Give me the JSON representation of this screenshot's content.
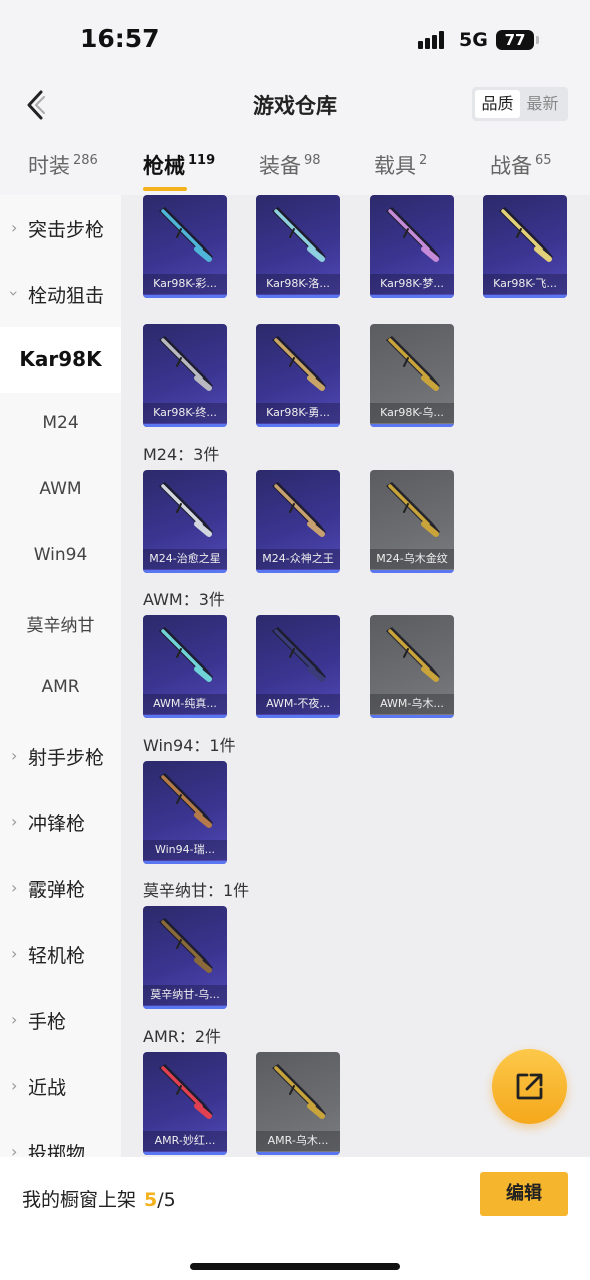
{
  "status": {
    "time": "16:57",
    "network": "5G",
    "battery": "77"
  },
  "header": {
    "title": "游戏仓库",
    "sort": [
      "品质",
      "最新"
    ]
  },
  "tabs": [
    {
      "label": "时装",
      "count": "286"
    },
    {
      "label": "枪械",
      "count": "119"
    },
    {
      "label": "装备",
      "count": "98"
    },
    {
      "label": "载具",
      "count": "2"
    },
    {
      "label": "战备",
      "count": "65"
    }
  ],
  "sidebar": [
    {
      "label": "突击步枪",
      "chevron": "chevron-right-icon"
    },
    {
      "label": "栓动狙击",
      "chevron": "chevron-down-icon"
    },
    {
      "label": "Kar98K"
    },
    {
      "label": "M24"
    },
    {
      "label": "AWM"
    },
    {
      "label": "Win94"
    },
    {
      "label": "莫辛纳甘"
    },
    {
      "label": "AMR"
    },
    {
      "label": "射手步枪",
      "chevron": "chevron-right-icon"
    },
    {
      "label": "冲锋枪",
      "chevron": "chevron-right-icon"
    },
    {
      "label": "霰弹枪",
      "chevron": "chevron-right-icon"
    },
    {
      "label": "轻机枪",
      "chevron": "chevron-right-icon"
    },
    {
      "label": "手枪",
      "chevron": "chevron-right-icon"
    },
    {
      "label": "近战",
      "chevron": "chevron-right-icon"
    },
    {
      "label": "投掷物",
      "chevron": "chevron-right-icon"
    }
  ],
  "sections": {
    "m24": "M24：3件",
    "awm": "AWM：3件",
    "win94": "Win94：1件",
    "mosin": "莫辛纳甘：1件",
    "amr": "AMR：2件"
  },
  "items": [
    {
      "name": "Kar98K-彩...",
      "rarity": "purple"
    },
    {
      "name": "Kar98K-洛...",
      "rarity": "purple"
    },
    {
      "name": "Kar98K-梦...",
      "rarity": "purple"
    },
    {
      "name": "Kar98K-飞...",
      "rarity": "purple"
    },
    {
      "name": "Kar98K-终...",
      "rarity": "purple"
    },
    {
      "name": "Kar98K-勇...",
      "rarity": "purple"
    },
    {
      "name": "Kar98K-乌...",
      "rarity": "gray"
    },
    {
      "name": "M24-治愈之星",
      "rarity": "purple"
    },
    {
      "name": "M24-众神之王",
      "rarity": "purple"
    },
    {
      "name": "M24-乌木金纹",
      "rarity": "gray"
    },
    {
      "name": "AWM-纯真...",
      "rarity": "purple"
    },
    {
      "name": "AWM-不夜...",
      "rarity": "purple"
    },
    {
      "name": "AWM-乌木...",
      "rarity": "gray"
    },
    {
      "name": "Win94-瑞...",
      "rarity": "purple"
    },
    {
      "name": "莫辛纳甘-乌...",
      "rarity": "purple"
    },
    {
      "name": "AMR-妙红...",
      "rarity": "purple"
    },
    {
      "name": "AMR-乌木...",
      "rarity": "gray"
    }
  ],
  "bottom": {
    "shelf_label": "我的橱窗上架",
    "used": "5",
    "total": "/5",
    "edit": "编辑"
  },
  "colors": {
    "accent": "#f3b21c",
    "purple_card": "#3b3591",
    "gray_card": "#6d6e72",
    "underline": "#5a76f0"
  }
}
